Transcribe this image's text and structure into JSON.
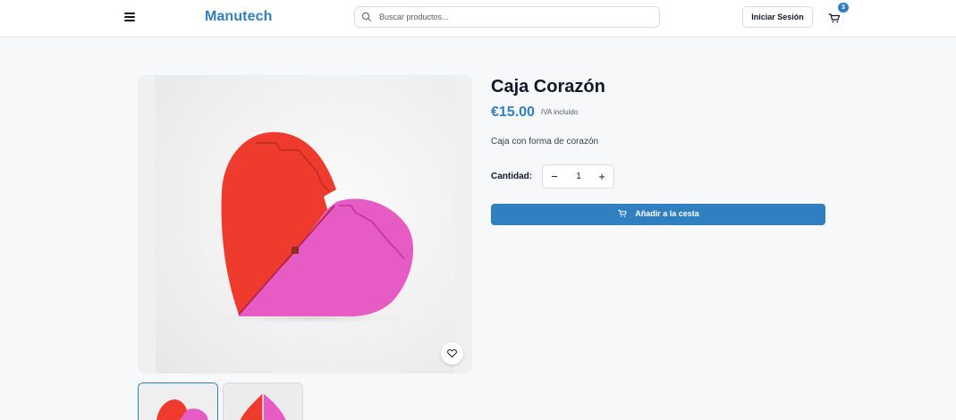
{
  "header": {
    "logo": "Manutech",
    "search_placeholder": "Buscar productos...",
    "login_label": "Iniciar Sesión",
    "cart_count": "3",
    "icons": [
      "menu-icon",
      "search-icon",
      "cart-icon"
    ]
  },
  "product": {
    "title": "Caja Corazón",
    "price": "€15.00",
    "tax_note": "IVA incluido",
    "description": "Caja con forma de corazón",
    "quantity_label": "Cantidad:",
    "quantity": "1",
    "add_to_cart_label": "Añadir a la cesta",
    "favorite_icon": "heart-icon",
    "colors": {
      "accent": "#2f7fc1",
      "heart_red": "#ef3b2d",
      "heart_pink": "#e65bc4"
    }
  }
}
